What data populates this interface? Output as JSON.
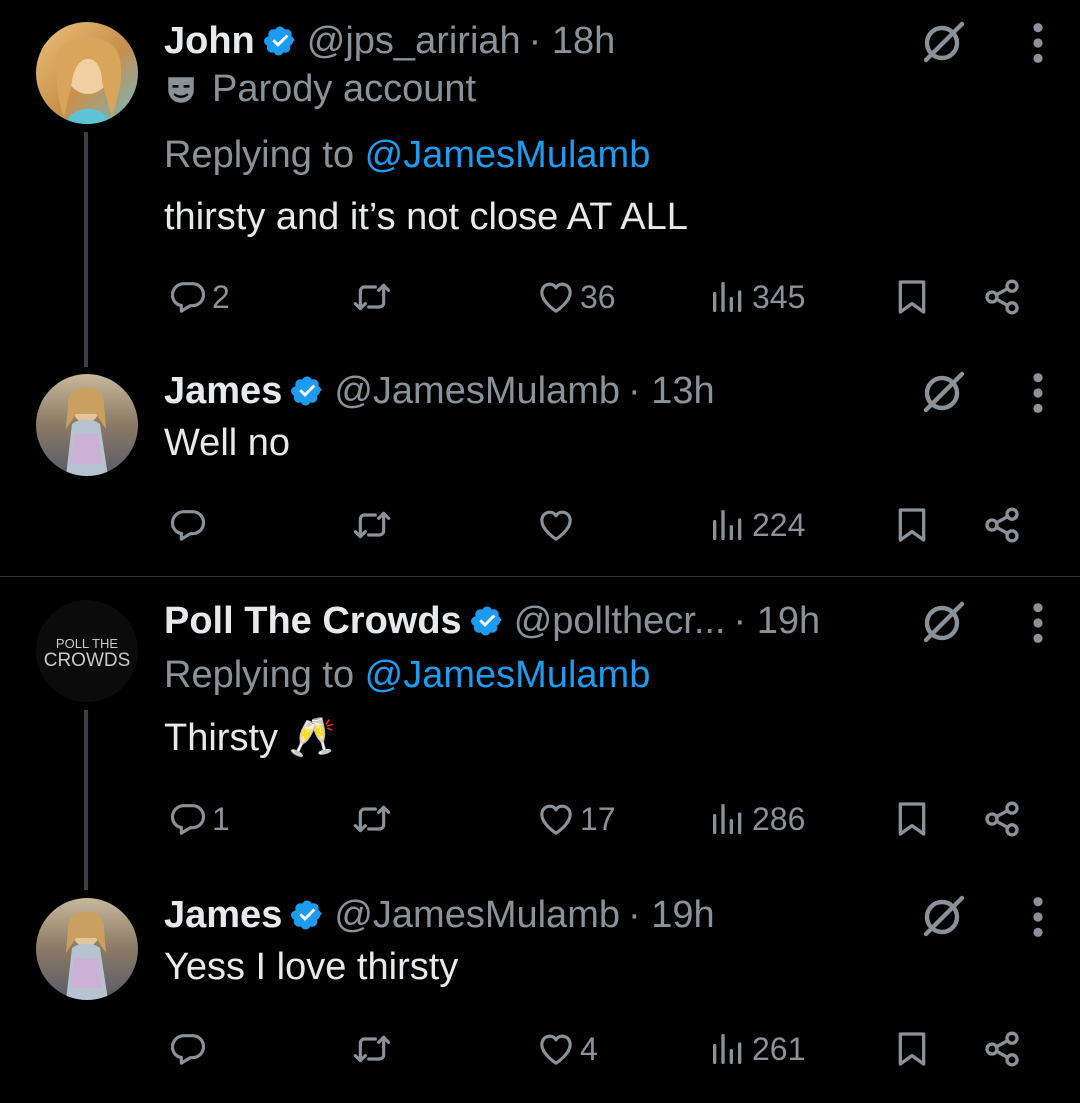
{
  "tweets": [
    {
      "name": "John",
      "handle": "@jps_aririah",
      "time": "· 18h",
      "parody_label": "Parody account",
      "replying_prefix": "Replying to ",
      "replying_to": "@JamesMulamb",
      "text": "thirsty and it’s not close AT ALL",
      "replies": "2",
      "likes": "36",
      "views": "345"
    },
    {
      "name": "James",
      "handle": "@JamesMulamb",
      "time": "· 13h",
      "text": "Well no",
      "replies": "",
      "likes": "",
      "views": "224"
    },
    {
      "name": "Poll The Crowds",
      "handle": "@pollthecr...",
      "time": "· 19h",
      "replying_prefix": "Replying to ",
      "replying_to": "@JamesMulamb",
      "text": "Thirsty 🥂",
      "avatar_line1": "POLL THE",
      "avatar_line2": "CROWDS",
      "replies": "1",
      "likes": "17",
      "views": "286"
    },
    {
      "name": "James",
      "handle": "@JamesMulamb",
      "time": "· 19h",
      "text": "Yess I love thirsty",
      "replies": "",
      "likes": "4",
      "views": "261"
    }
  ],
  "colors": {
    "background": "#000000",
    "text": "#e7e9ea",
    "muted": "#8b9198",
    "accent": "#1d9bf0",
    "verified": "#1d9bf0"
  },
  "icons": [
    "verified-badge-icon",
    "grok-icon",
    "more-icon",
    "parody-mask-icon",
    "reply-icon",
    "retweet-icon",
    "like-icon",
    "views-icon",
    "bookmark-icon",
    "share-icon"
  ]
}
